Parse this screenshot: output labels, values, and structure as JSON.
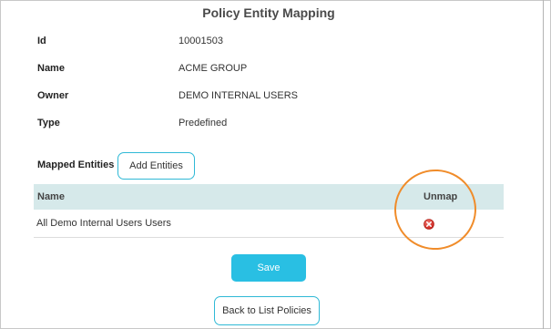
{
  "page": {
    "title": "Policy Entity Mapping"
  },
  "fields": {
    "id_label": "Id",
    "id_value": "10001503",
    "name_label": "Name",
    "name_value": "ACME GROUP",
    "owner_label": "Owner",
    "owner_value": "DEMO INTERNAL USERS",
    "type_label": "Type",
    "type_value": "Predefined"
  },
  "mapped_entities": {
    "label": "Mapped Entities :",
    "add_button_label": "Add Entities"
  },
  "table": {
    "headers": {
      "name": "Name",
      "unmap": "Unmap"
    },
    "rows": [
      {
        "name": "All Demo Internal Users Users",
        "unmap_icon": "remove-circle-icon"
      }
    ]
  },
  "actions": {
    "save_label": "Save",
    "back_label": "Back to List Policies"
  },
  "colors": {
    "accent": "#29bfe3",
    "header_bg": "#d6e9ea",
    "annotation": "#f08c2a",
    "remove_icon": "#d9322d"
  }
}
